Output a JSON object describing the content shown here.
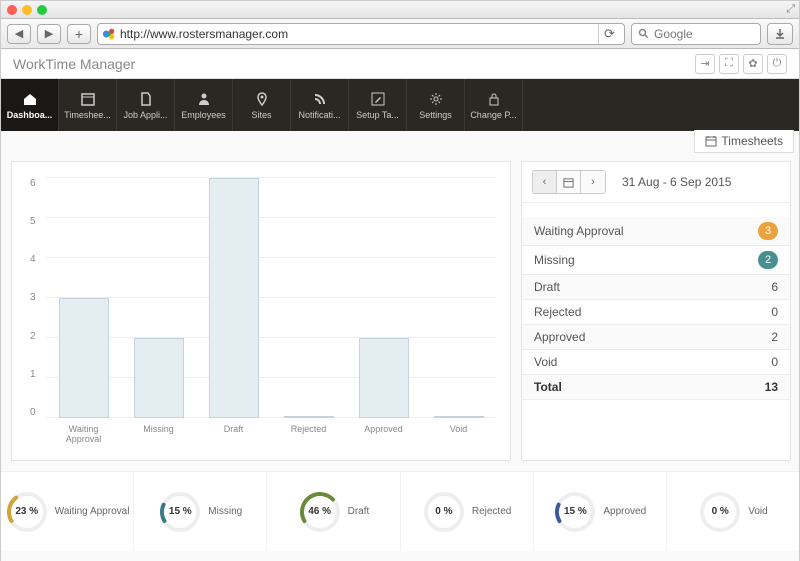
{
  "browser": {
    "url": "http://www.rostersmanager.com",
    "search_placeholder": "Google"
  },
  "app": {
    "title": "WorkTime Manager"
  },
  "nav": {
    "items": [
      {
        "label": "Dashboa...",
        "icon": "home",
        "active": true
      },
      {
        "label": "Timeshee...",
        "icon": "calendar"
      },
      {
        "label": "Job Appli...",
        "icon": "file"
      },
      {
        "label": "Employees",
        "icon": "person"
      },
      {
        "label": "Sites",
        "icon": "pin"
      },
      {
        "label": "Notificati...",
        "icon": "rss"
      },
      {
        "label": "Setup Ta...",
        "icon": "edit"
      },
      {
        "label": "Settings",
        "icon": "gear"
      },
      {
        "label": "Change P...",
        "icon": "lock"
      }
    ]
  },
  "right_tab": {
    "label": "Timesheets"
  },
  "date_nav": {
    "range": "31 Aug - 6 Sep 2015"
  },
  "stats": {
    "rows": [
      {
        "label": "Waiting Approval",
        "value": 3,
        "badge": "orange"
      },
      {
        "label": "Missing",
        "value": 2,
        "badge": "teal"
      },
      {
        "label": "Draft",
        "value": 6
      },
      {
        "label": "Rejected",
        "value": 0
      },
      {
        "label": "Approved",
        "value": 2
      },
      {
        "label": "Void",
        "value": 0
      }
    ],
    "total_label": "Total",
    "total_value": 13
  },
  "chart_data": {
    "type": "bar",
    "categories": [
      "Waiting Approval",
      "Missing",
      "Draft",
      "Rejected",
      "Approved",
      "Void"
    ],
    "values": [
      3,
      2,
      6,
      0,
      2,
      0
    ],
    "ylim": [
      0,
      6
    ],
    "yticks": [
      0,
      1,
      2,
      3,
      4,
      5,
      6
    ],
    "title": "",
    "xlabel": "",
    "ylabel": ""
  },
  "gauges": [
    {
      "pct": "23 %",
      "label": "Waiting Approval",
      "color": "#d4a23a",
      "frac": 0.23
    },
    {
      "pct": "15 %",
      "label": "Missing",
      "color": "#3a7a8a",
      "frac": 0.15
    },
    {
      "pct": "46 %",
      "label": "Draft",
      "color": "#6a8a3a",
      "frac": 0.46
    },
    {
      "pct": "0 %",
      "label": "Rejected",
      "color": "#888",
      "frac": 0
    },
    {
      "pct": "15 %",
      "label": "Approved",
      "color": "#3a5a9a",
      "frac": 0.15
    },
    {
      "pct": "0 %",
      "label": "Void",
      "color": "#888",
      "frac": 0
    }
  ]
}
